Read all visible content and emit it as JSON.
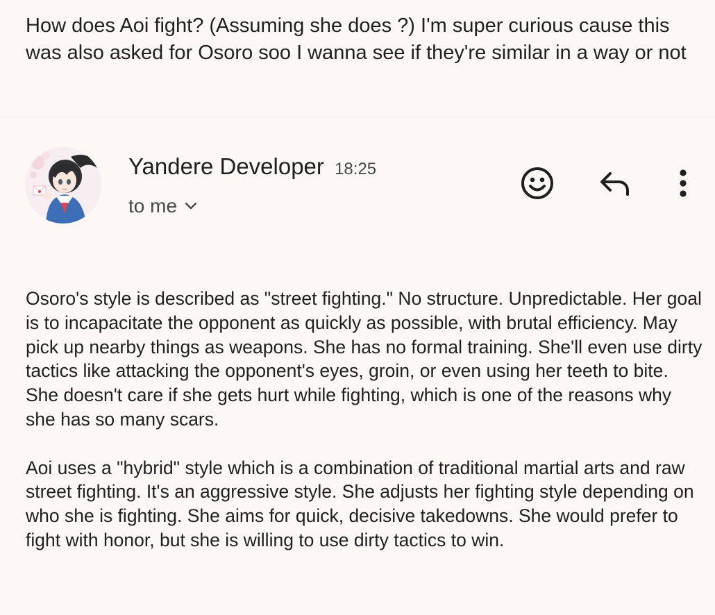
{
  "quoted_question": "How does Aoi fight? (Assuming she does ?) I'm super curious cause this was also asked for Osoro soo I wanna see if they're similar in a way or not",
  "message": {
    "sender": "Yandere Developer",
    "time": "18:25",
    "recipient_label": "to me",
    "avatar": "anime-schoolgirl-avatar",
    "paragraphs": [
      "Osoro's style is described as \"street fighting.\" No structure. Unpredictable. Her goal is to incapacitate the opponent as quickly as possible, with brutal efficiency. May pick up nearby things as weapons. She has no formal training. She'll even use dirty tactics like attacking the opponent's eyes, groin, or even using her teeth to bite. She doesn't care if she gets hurt while fighting, which is one of the reasons why she has so many scars.",
      "Aoi uses a \"hybrid\" style which is a combination of traditional martial arts and raw street fighting. It's an aggressive style. She adjusts her fighting style depending on who she is fighting. She aims for quick, decisive takedowns. She would prefer to fight with honor, but she is willing to use dirty tactics to win."
    ]
  },
  "actions": {
    "emoji_icon": "add-reaction-icon",
    "reply_icon": "reply-icon",
    "more_icon": "more-vertical-icon",
    "expand_icon": "chevron-down-icon"
  },
  "colors": {
    "background": "#fdf8f5",
    "text": "#1f1f1f",
    "secondary_text": "#444746"
  }
}
